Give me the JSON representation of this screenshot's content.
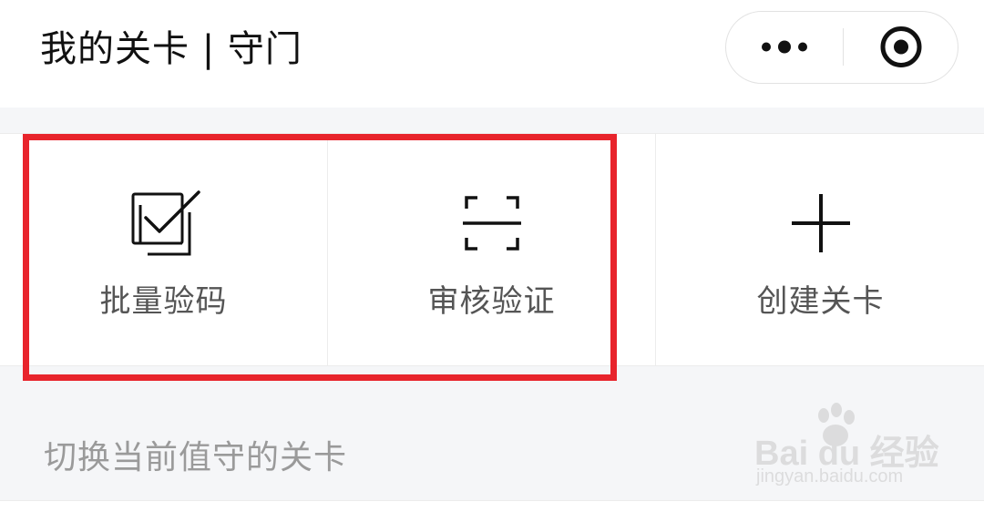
{
  "header": {
    "title": "我的关卡 | 守门"
  },
  "capsule": {
    "more_icon": "more-dots-icon",
    "close_icon": "target-circle-icon"
  },
  "actions": [
    {
      "label": "批量验码",
      "icon": "batch-check-icon"
    },
    {
      "label": "审核验证",
      "icon": "scan-frame-icon"
    },
    {
      "label": "创建关卡",
      "icon": "plus-icon"
    }
  ],
  "highlight_color": "#e8242c",
  "section": {
    "switch_label": "切换当前值守的关卡"
  },
  "watermark": {
    "main": "Bai du 经验",
    "sub": "jingyan.baidu.com"
  }
}
